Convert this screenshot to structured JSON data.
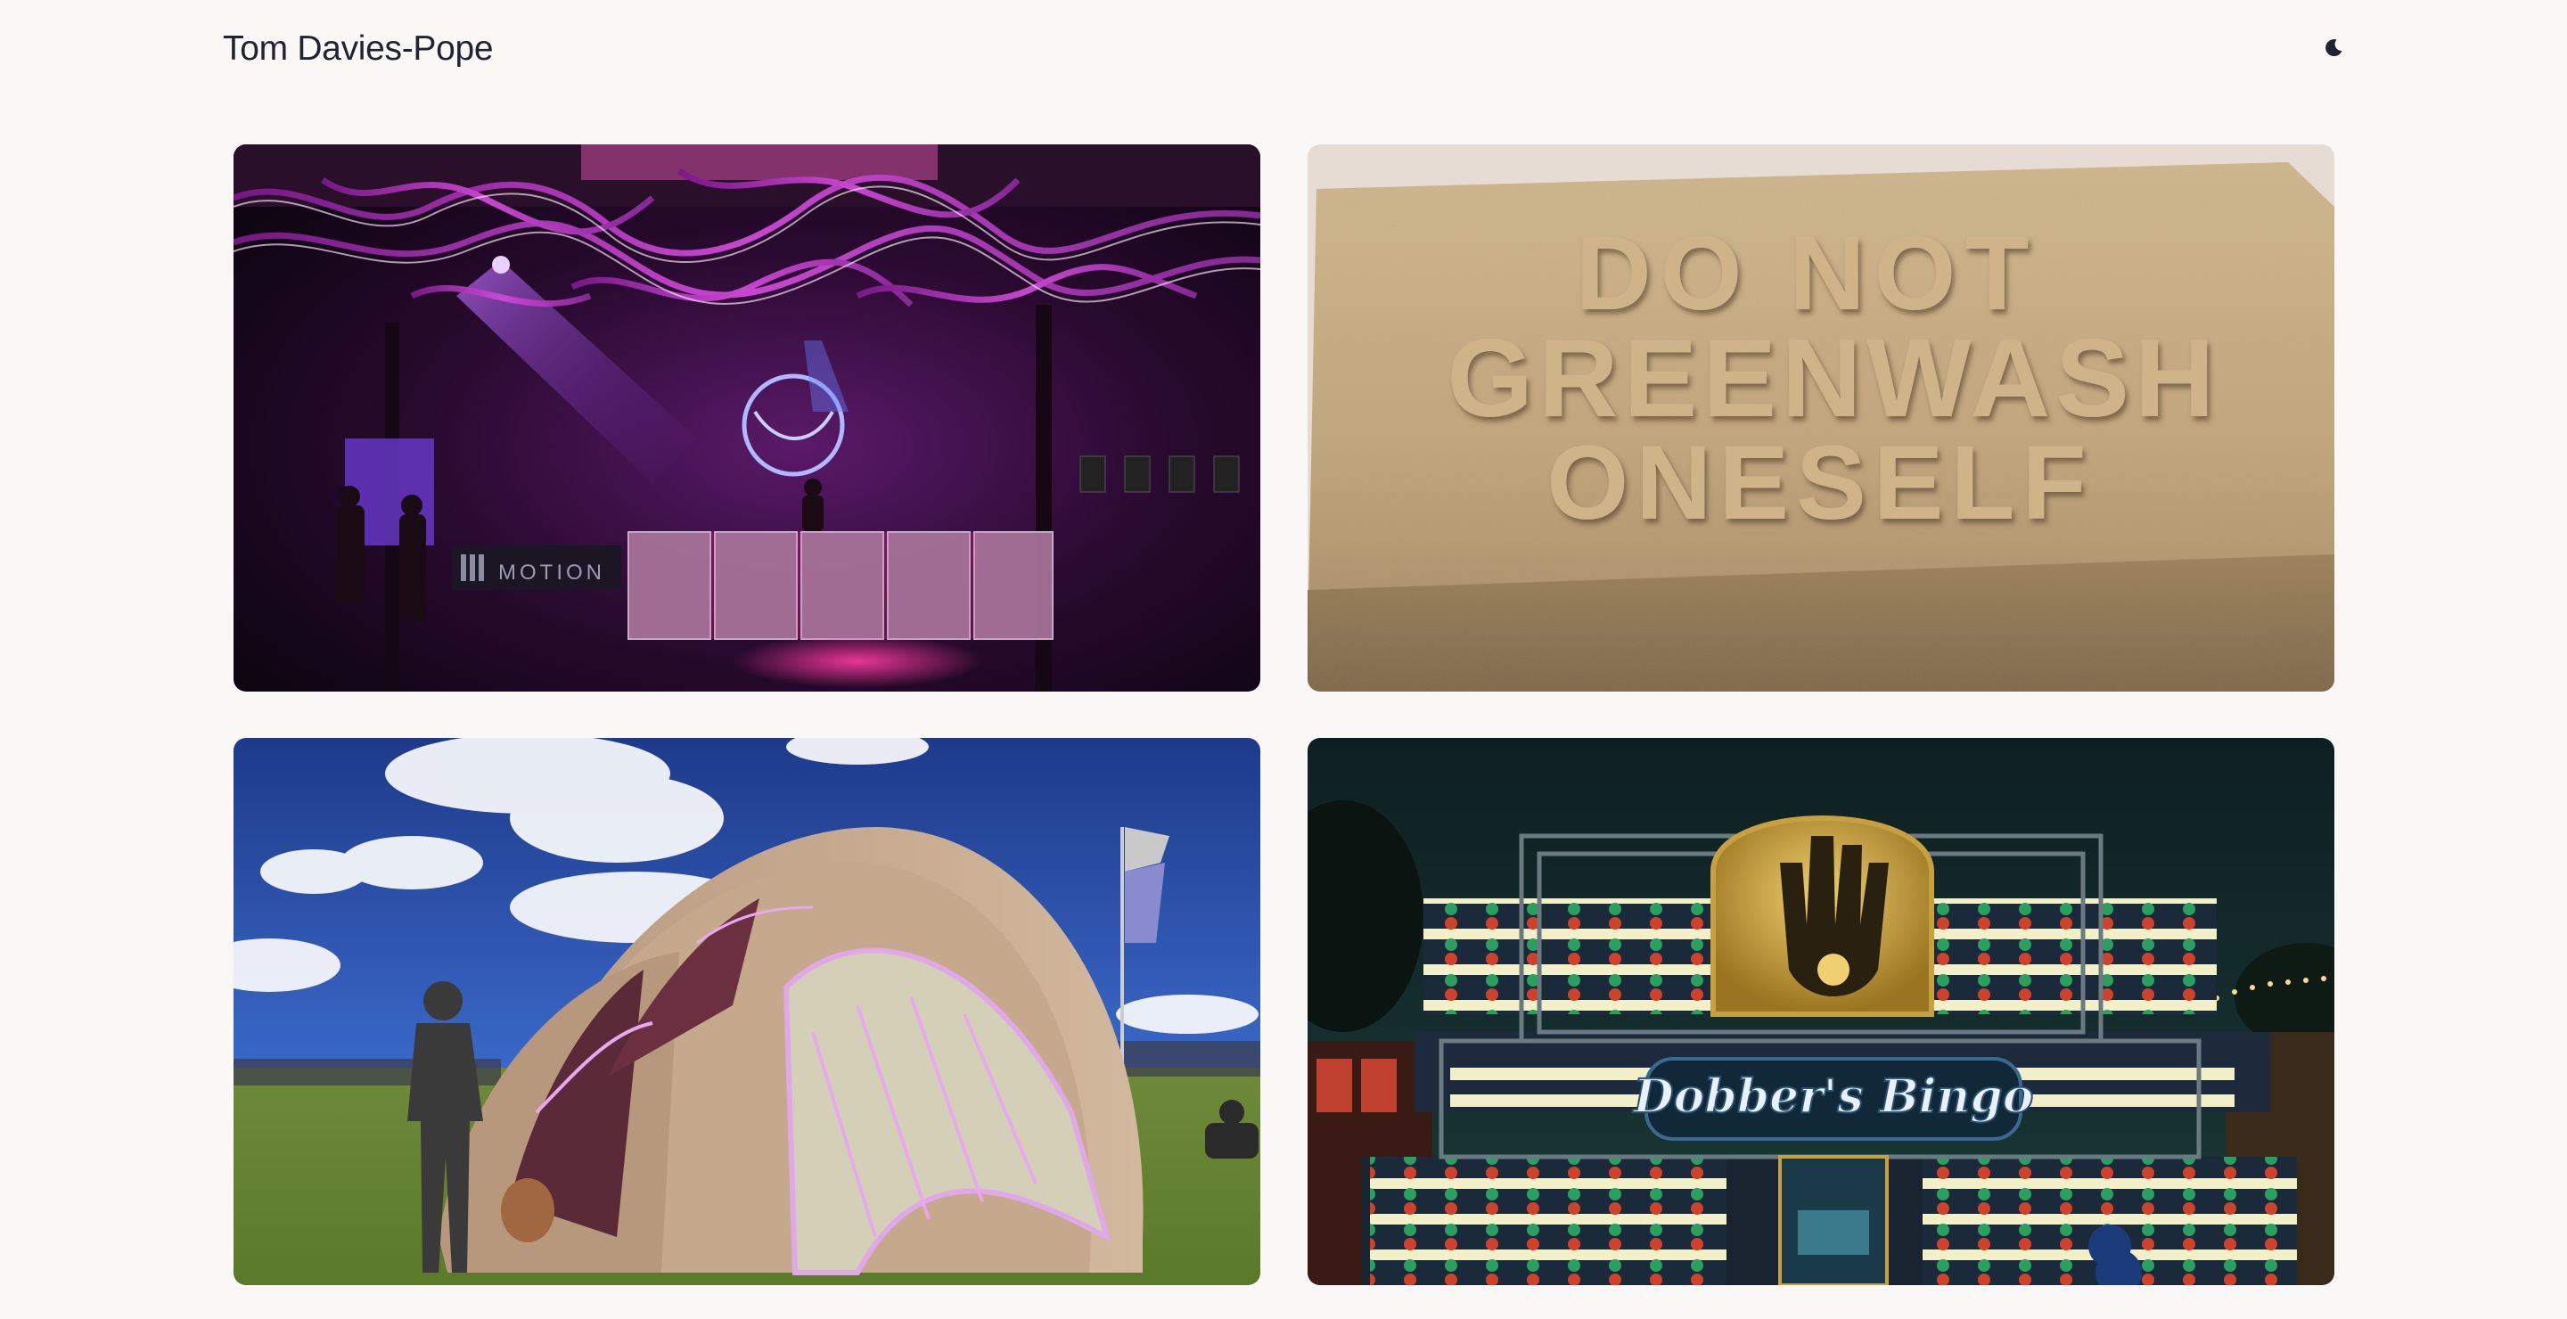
{
  "header": {
    "site_title": "Tom Davies-Pope",
    "theme_toggle_icon": "moon-icon"
  },
  "projects": [
    {
      "image": "neon-stage-installation",
      "banner_text": "MOTION"
    },
    {
      "image": "sand-sign-sculpture",
      "sign_lines": [
        "DO NOT",
        "GREENWASH",
        "ONESELF"
      ]
    },
    {
      "image": "festival-dome-pavilion"
    },
    {
      "image": "bingo-stall-facade",
      "sign_text": "Dobber's Bingo"
    }
  ],
  "colors": {
    "background": "#faf8f6",
    "text": "#1f2430",
    "neon_pink": "#e040c8",
    "sand": "#c8ad83"
  }
}
